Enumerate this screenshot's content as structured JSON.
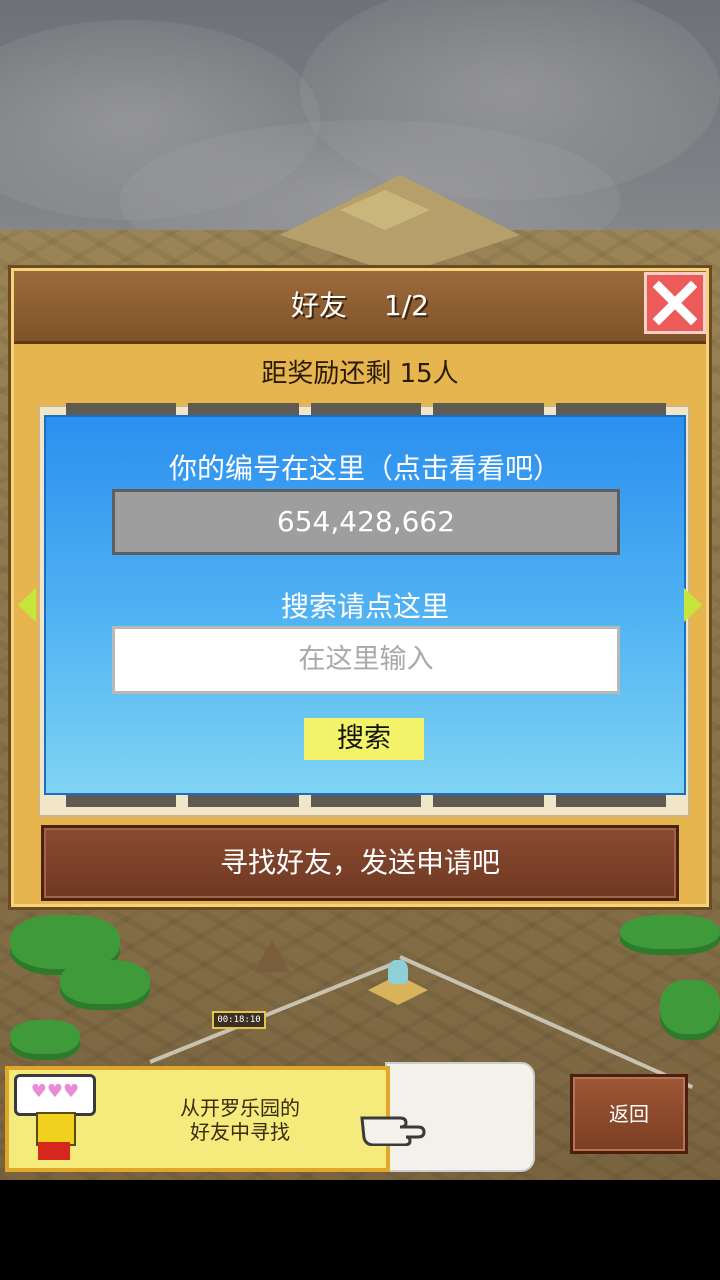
{
  "dialog": {
    "title": "好友　 1/2",
    "reward_text": "距奖励还剩 15人",
    "id_label": "你的编号在这里（点击看看吧）",
    "player_id": "654,428,662",
    "search_label": "搜索请点这里",
    "search_placeholder": "在这里输入",
    "search_button": "搜索",
    "find_friends_button": "寻找好友，发送申请吧"
  },
  "scene": {
    "timer_text": "00:18:10"
  },
  "bottom_bar": {
    "friend_card_text_line1": "从开罗乐园的",
    "friend_card_text_line2": "好友中寻找",
    "bubble_hearts": "♥♥♥",
    "back_button": "返回"
  },
  "colors": {
    "dialog_bg": "#e7b54e",
    "title_bar": "#8a5a2f",
    "close_button": "#ec5a5a",
    "panel_blue": "#2b8ff0",
    "search_button": "#f3f36a",
    "action_button": "#7d3e22",
    "friend_card": "#f5ea7c"
  },
  "icons": [
    "close-icon",
    "left-arrow-icon",
    "right-arrow-icon",
    "pointing-hand-icon",
    "robot-avatar-icon",
    "heart-bubble-icon"
  ]
}
